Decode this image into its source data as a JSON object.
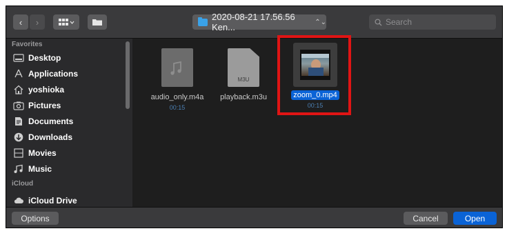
{
  "toolbar": {
    "path_label": "2020-08-21 17.56.56 Ken...",
    "search_placeholder": "Search"
  },
  "sidebar": {
    "favorites_label": "Favorites",
    "items": [
      {
        "label": "Desktop",
        "icon": "desktop-icon"
      },
      {
        "label": "Applications",
        "icon": "applications-icon"
      },
      {
        "label": "yoshioka",
        "icon": "home-icon"
      },
      {
        "label": "Pictures",
        "icon": "pictures-icon"
      },
      {
        "label": "Documents",
        "icon": "documents-icon"
      },
      {
        "label": "Downloads",
        "icon": "downloads-icon"
      },
      {
        "label": "Movies",
        "icon": "movies-icon"
      },
      {
        "label": "Music",
        "icon": "music-icon"
      }
    ],
    "icloud_label": "iCloud",
    "icloud_item": "iCloud Drive"
  },
  "files": [
    {
      "name": "audio_only.m4a",
      "duration": "00:15",
      "type_label": ""
    },
    {
      "name": "playback.m3u",
      "duration": "",
      "type_label": "M3U"
    },
    {
      "name": "zoom_0.mp4",
      "duration": "00:15",
      "type_label": ""
    }
  ],
  "footer": {
    "options_label": "Options",
    "cancel_label": "Cancel",
    "open_label": "Open"
  },
  "colors": {
    "accent": "#0a63d6",
    "highlight_box": "#e01414",
    "folder": "#3aa2e8"
  }
}
